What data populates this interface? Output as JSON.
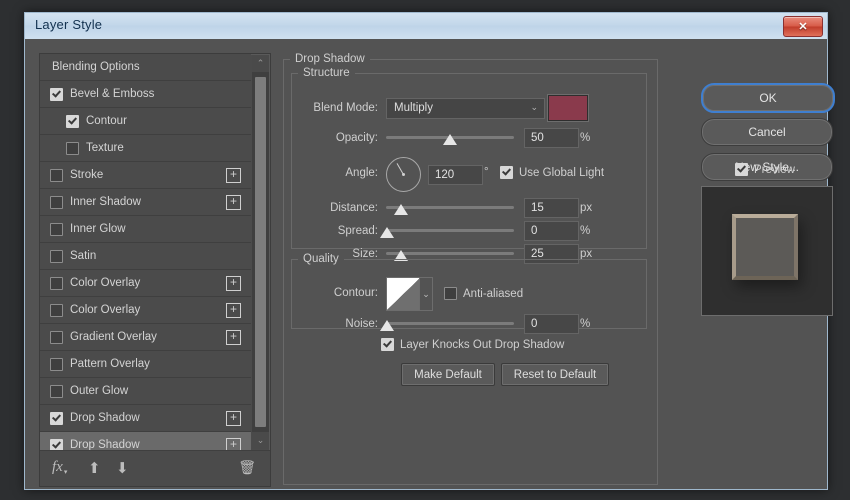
{
  "window": {
    "title": "Layer Style",
    "close_label": "✕"
  },
  "effects_list": {
    "items": [
      {
        "label": "Blending Options",
        "checkbox": null,
        "indent": false,
        "plus": false,
        "selected": false
      },
      {
        "label": "Bevel & Emboss",
        "checkbox": true,
        "indent": false,
        "plus": false,
        "selected": false
      },
      {
        "label": "Contour",
        "checkbox": true,
        "indent": true,
        "plus": false,
        "selected": false
      },
      {
        "label": "Texture",
        "checkbox": false,
        "indent": true,
        "plus": false,
        "selected": false
      },
      {
        "label": "Stroke",
        "checkbox": false,
        "indent": false,
        "plus": true,
        "selected": false
      },
      {
        "label": "Inner Shadow",
        "checkbox": false,
        "indent": false,
        "plus": true,
        "selected": false
      },
      {
        "label": "Inner Glow",
        "checkbox": false,
        "indent": false,
        "plus": false,
        "selected": false
      },
      {
        "label": "Satin",
        "checkbox": false,
        "indent": false,
        "plus": false,
        "selected": false
      },
      {
        "label": "Color Overlay",
        "checkbox": false,
        "indent": false,
        "plus": true,
        "selected": false
      },
      {
        "label": "Color Overlay",
        "checkbox": false,
        "indent": false,
        "plus": true,
        "selected": false
      },
      {
        "label": "Gradient Overlay",
        "checkbox": false,
        "indent": false,
        "plus": true,
        "selected": false
      },
      {
        "label": "Pattern Overlay",
        "checkbox": false,
        "indent": false,
        "plus": false,
        "selected": false
      },
      {
        "label": "Outer Glow",
        "checkbox": false,
        "indent": false,
        "plus": false,
        "selected": false
      },
      {
        "label": "Drop Shadow",
        "checkbox": true,
        "indent": false,
        "plus": true,
        "selected": false
      },
      {
        "label": "Drop Shadow",
        "checkbox": true,
        "indent": false,
        "plus": true,
        "selected": true
      }
    ],
    "plus_glyph": "+",
    "scroll_up_glyph": "⌃",
    "scroll_down_glyph": "⌄",
    "toolbar": {
      "fx_label": "fx",
      "fx_caret": "▾",
      "move_up_glyph": "⬆",
      "move_down_glyph": "⬇",
      "delete_glyph": "🗑"
    }
  },
  "panel": {
    "effect_title": "Drop Shadow",
    "structure": {
      "legend": "Structure",
      "blend_mode_label": "Blend Mode:",
      "blend_mode_value": "Multiply",
      "shadow_color": "#8a3a4c",
      "opacity_label": "Opacity:",
      "opacity_value": "50",
      "opacity_unit": "%",
      "angle_label": "Angle:",
      "angle_value": "120",
      "angle_unit": "°",
      "use_global_light_label": "Use Global Light",
      "use_global_light_checked": true,
      "distance_label": "Distance:",
      "distance_value": "15",
      "distance_unit": "px",
      "spread_label": "Spread:",
      "spread_value": "0",
      "spread_unit": "%",
      "size_label": "Size:",
      "size_value": "25",
      "size_unit": "px"
    },
    "quality": {
      "legend": "Quality",
      "contour_label": "Contour:",
      "anti_aliased_label": "Anti-aliased",
      "anti_aliased_checked": false,
      "noise_label": "Noise:",
      "noise_value": "0",
      "noise_unit": "%",
      "contour_chevron": "⌄"
    },
    "knockout_label": "Layer Knocks Out Drop Shadow",
    "knockout_checked": true,
    "make_default_label": "Make Default",
    "reset_default_label": "Reset to Default"
  },
  "actions": {
    "ok_label": "OK",
    "cancel_label": "Cancel",
    "new_style_label": "New Style...",
    "preview_label": "Preview",
    "preview_checked": true,
    "focus_color": "#3f7fd0"
  }
}
